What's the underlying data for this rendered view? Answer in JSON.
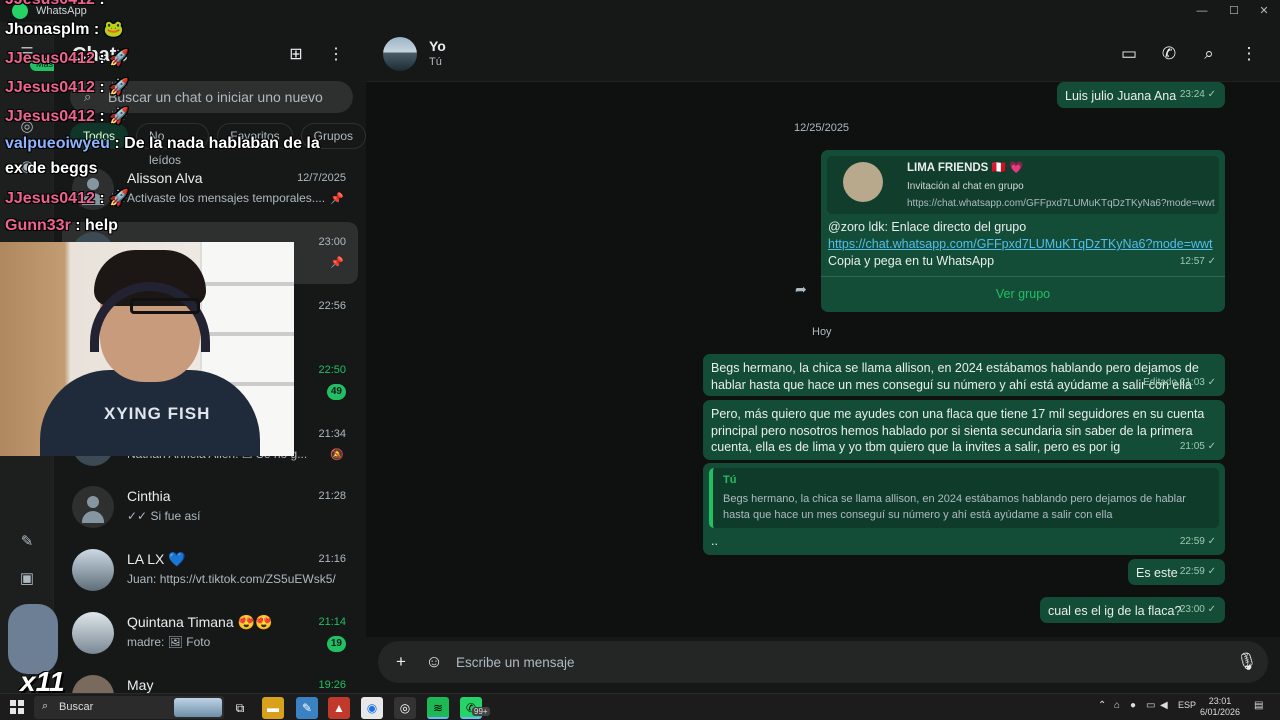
{
  "window": {
    "title": "WhatsApp"
  },
  "sidebar_panel": {
    "title": "Chats",
    "search_placeholder": "Buscar un chat o iniciar uno nuevo",
    "filters": [
      "Todos",
      "No leídos",
      "Favoritos",
      "Grupos"
    ],
    "rail_badge": "Más",
    "chats": [
      {
        "name": "Alisson Alva",
        "time": "12/7/2025",
        "preview": "Activaste los mensajes temporales....",
        "pinned": true,
        "badge": ""
      },
      {
        "name": "",
        "time": "23:00",
        "preview": "",
        "pinned": true,
        "badge": "",
        "selected": true
      },
      {
        "name": "",
        "time": "22:56",
        "preview": "",
        "pinned": false,
        "badge": ""
      },
      {
        "name": "",
        "time": "22:50",
        "preview": "...",
        "pinned": false,
        "badge": "49",
        "muted": true,
        "time_green": true
      },
      {
        "name": "",
        "time": "21:34",
        "preview": "Nathan Annela Allen: ☐ Se no g...",
        "pinned": false,
        "badge": "",
        "muted": true
      },
      {
        "name": "Cinthia",
        "time": "21:28",
        "preview": "✓✓ Si fue así",
        "pinned": false,
        "badge": ""
      },
      {
        "name": "LA LX 💙",
        "time": "21:16",
        "preview": "Juan: https://vt.tiktok.com/ZS5uEWsk5/",
        "pinned": false,
        "badge": ""
      },
      {
        "name": "Quintana Timana 😍😍",
        "time": "21:14",
        "preview": "madre: 🖼 Foto",
        "pinned": false,
        "badge": "19",
        "time_green": true
      },
      {
        "name": "May",
        "time": "19:26",
        "preview": "",
        "pinned": false,
        "badge": "",
        "time_green": true
      }
    ]
  },
  "conversation": {
    "name": "Yo",
    "subtitle": "Tú",
    "composer_placeholder": "Escribe un mensaje",
    "dates": {
      "first": "12/25/2025",
      "today": "Hoy"
    },
    "messages": {
      "m1": {
        "text": "Luis julio  Juana Ana",
        "time": "23:24 ✓"
      },
      "invite": {
        "group_name": "LIMA FRIENDS 🇵🇪 💗",
        "invite_label": "Invitación al chat en grupo",
        "invite_url": "https://chat.whatsapp.com/GFFpxd7LUMuKTqDzTKyNa6?mode=wwt",
        "line1": "@zoro ldk: Enlace directo del grupo",
        "link": "https://chat.whatsapp.com/GFFpxd7LUMuKTqDzTKyNa6?mode=wwt",
        "line3": "Copia y pega en tu WhatsApp",
        "time": "12:57 ✓",
        "action": "Ver grupo"
      },
      "m2": {
        "text": "Begs hermano, la chica se llama allison, en 2024 estábamos hablando pero dejamos de hablar hasta que hace un mes conseguí su número y ahí está ayúdame a salir con ella",
        "time": "Editado 21:03 ✓"
      },
      "m3": {
        "text": "Pero, más quiero que me ayudes con una flaca que tiene 17 mil seguidores en su cuenta principal pero nosotros hemos hablado por si sienta secundaria sin saber de la primera cuenta, ella es de lima y yo tbm quiero que la invites a salir, pero es por ig",
        "time": "21:05 ✓"
      },
      "m4": {
        "quote_author": "Tú",
        "quote_text": "Begs hermano, la chica se llama allison, en 2024 estábamos hablando pero dejamos de hablar hasta que hace un mes conseguí su número y ahí está ayúdame a salir con ella",
        "text": "..",
        "time": "22:59 ✓"
      },
      "m5": {
        "text": "Es este",
        "time": "22:59 ✓"
      },
      "m6": {
        "text": "cual es el ig de la flaca?",
        "time": "23:00 ✓"
      }
    }
  },
  "stream_overlay": {
    "chat": [
      {
        "user": "JJesus0412",
        "msg": ":",
        "color": "pink"
      },
      {
        "user": "Jhonasplm",
        "msg": ": 🐸",
        "color": "white"
      },
      {
        "user": "JJesus0412",
        "msg": ": 🚀",
        "color": "pink"
      },
      {
        "user": "JJesus0412",
        "msg": ": 🚀",
        "color": "pink"
      },
      {
        "user": "JJesus0412",
        "msg": ": 🚀",
        "color": "pink"
      },
      {
        "user": "valpueoiwyeu",
        "msg": ": De la nada hablaban de la",
        "color": "blue"
      },
      {
        "user": "",
        "msg": "ex de beggs",
        "color": "white"
      },
      {
        "user": "JJesus0412",
        "msg": ": 🚀",
        "color": "pink"
      },
      {
        "user": "Gunn33r",
        "msg": ": help",
        "color": "pink"
      }
    ],
    "webcam_shirt_text": "XYING FISH",
    "multiplier": "x11"
  },
  "taskbar": {
    "search_label": "Buscar",
    "lang": "ESP",
    "clock_time": "23:01",
    "clock_date": "6/01/2026",
    "wa_badge": "99+"
  },
  "colors": {
    "accent": "#21c063",
    "bubble_out": "#144d37",
    "panel": "#161717"
  }
}
